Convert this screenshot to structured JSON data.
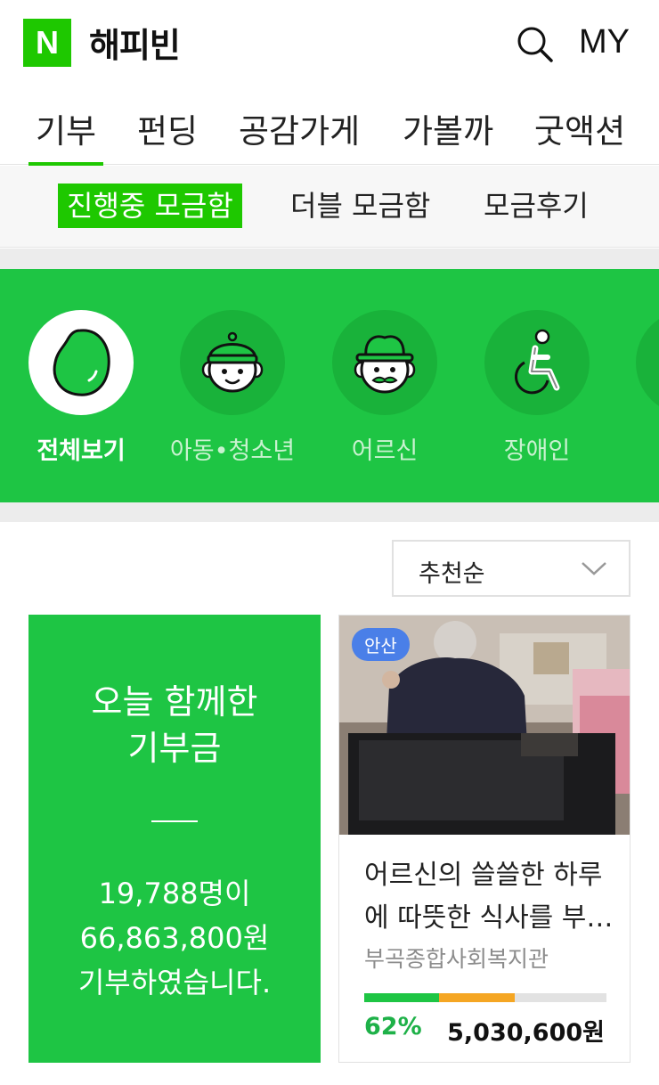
{
  "header": {
    "logo_letter": "N",
    "brand": "해피빈",
    "my_label": "MY"
  },
  "nav": {
    "items": [
      {
        "label": "기부",
        "active": true
      },
      {
        "label": "펀딩"
      },
      {
        "label": "공감가게"
      },
      {
        "label": "가볼까"
      },
      {
        "label": "굿액션"
      }
    ]
  },
  "subnav": {
    "items": [
      {
        "label": "진행중 모금함",
        "active": true
      },
      {
        "label": "더블 모금함"
      },
      {
        "label": "모금후기"
      }
    ]
  },
  "categories": {
    "items": [
      {
        "label": "전체보기",
        "icon": "bean-icon",
        "active": true
      },
      {
        "label": "아동•청소년",
        "icon": "child-icon"
      },
      {
        "label": "어르신",
        "icon": "elder-icon"
      },
      {
        "label": "장애인",
        "icon": "wheelchair-icon"
      }
    ]
  },
  "sort": {
    "selected": "추천순"
  },
  "summary": {
    "title_line1": "오늘 함께한",
    "title_line2": "기부금",
    "donors": "19,788명이",
    "amount": "66,863,800원",
    "suffix": "기부하였습니다."
  },
  "card": {
    "region": "안산",
    "title_line1": "어르신의 쓸쓸한 하루",
    "title_line2": "에 따뜻한 식사를 부…",
    "org": "부곡종합사회복지관",
    "percent_text": "62%",
    "amount": "5,030,600원",
    "progress": {
      "green_fraction": 0.31,
      "orange_fraction": 0.31
    }
  },
  "colors": {
    "brand_green": "#1ec800",
    "band_green": "#1ec544",
    "accent_orange": "#f5a623",
    "badge_blue": "#4a7fe8"
  }
}
